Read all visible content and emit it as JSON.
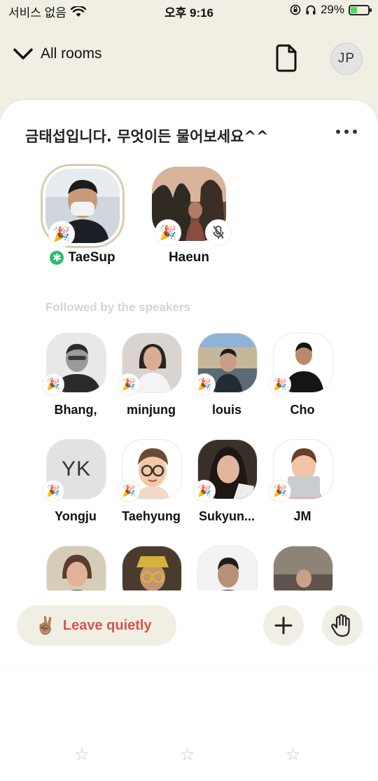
{
  "status_bar": {
    "carrier": "서비스 없음",
    "time": "오후 9:16",
    "battery": "29%"
  },
  "nav": {
    "back_label": "All rooms",
    "avatar_initials": "JP"
  },
  "room": {
    "title": "금태섭입니다. 무엇이든 물어보세요^^"
  },
  "speakers": [
    {
      "name": "TaeSup",
      "moderator": true
    },
    {
      "name": "Haeun",
      "muted": true
    }
  ],
  "section": {
    "followed_label": "Followed by the speakers"
  },
  "listeners": [
    {
      "name": "Bhang,"
    },
    {
      "name": "minjung"
    },
    {
      "name": "louis"
    },
    {
      "name": "Cho"
    },
    {
      "name": "Yongju",
      "initials": "YK"
    },
    {
      "name": "Taehyung"
    },
    {
      "name": "Sukyun..."
    },
    {
      "name": "JM"
    }
  ],
  "actions": {
    "leave_label": "Leave quietly",
    "leave_emoji": "✌🏽",
    "add_icon": "plus-icon",
    "raise_hand_icon": "raise-hand-icon"
  },
  "badge_emoji": "🎉",
  "colors": {
    "header_bg": "#f1efe4",
    "leave_text": "#d9534f",
    "moderator_green": "#2bbd71",
    "section_label": "#d4d4d4"
  }
}
